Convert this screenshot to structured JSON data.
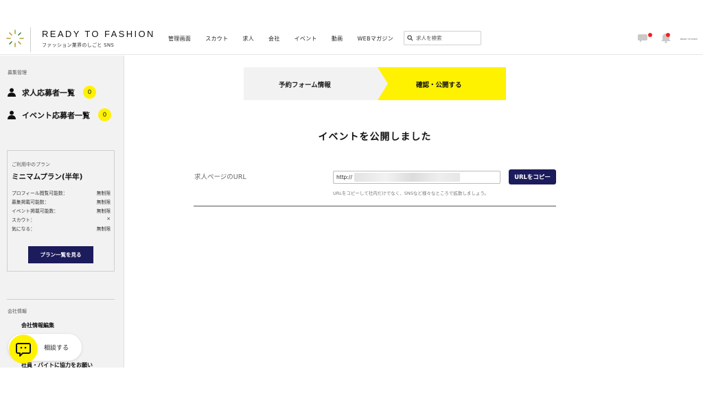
{
  "header": {
    "brand_name": "READY TO FASHION",
    "brand_sub": "ファッション業界のしごと SNS",
    "nav": [
      "管理画面",
      "スカウト",
      "求人",
      "会社",
      "イベント",
      "動画",
      "WEBマガジン"
    ],
    "search_placeholder": "求人を検索",
    "tiny_label": "READY TO FASHI"
  },
  "sidebar": {
    "section_recruit": "募集管理",
    "links": [
      {
        "label": "求人応募者一覧",
        "count": "0"
      },
      {
        "label": "イベント応募者一覧",
        "count": "0"
      }
    ],
    "plan": {
      "caption": "ご利用中のプラン",
      "name": "ミニマムプラン(半年)",
      "rows": [
        {
          "label": "プロフィール閲覧可能数：",
          "value": "無制限"
        },
        {
          "label": "募集掲載可能数：",
          "value": "無制限"
        },
        {
          "label": "イベント掲載可能数：",
          "value": "無制限"
        },
        {
          "label": "スカウト：",
          "value": "×"
        },
        {
          "label": "気になる：",
          "value": "無制限"
        }
      ],
      "button": "プラン一覧を見る"
    },
    "section_company": "会社情報",
    "company_links": [
      "会社情報編集",
      "社員・バイトに協力をお願い"
    ]
  },
  "consult": {
    "label": "相談する"
  },
  "steps": [
    {
      "label": "予約フォーム情報"
    },
    {
      "label": "確認・公開する"
    }
  ],
  "main": {
    "title": "イベントを公開しました",
    "url_label": "求人ページのURL",
    "url_value": "http://",
    "copy_button": "URLをコピー",
    "hint": "URLをコピーして社内だけでなく、SNSなど様々なところで拡散しましょう。"
  },
  "colors": {
    "accent_yellow": "#fff200",
    "navy": "#1c1b5c",
    "notification_red": "#ff1a1a"
  },
  "icons": [
    "logo-mark-icon",
    "search-icon",
    "chat-icon",
    "bell-icon",
    "person-icon",
    "chat-face-icon"
  ]
}
